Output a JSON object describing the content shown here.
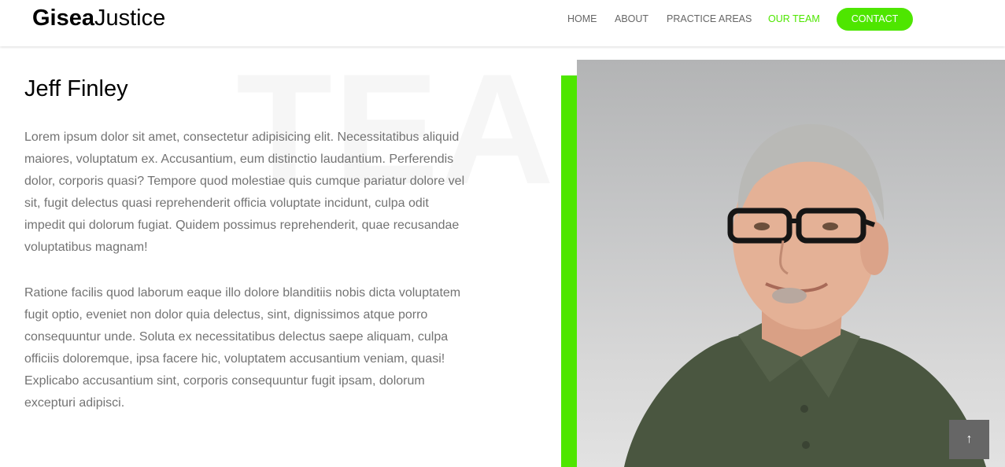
{
  "brand": {
    "bold": "Gisea",
    "regular": "Justice"
  },
  "nav": {
    "items": [
      "HOME",
      "ABOUT",
      "PRACTICE AREAS",
      "OUR TEAM"
    ],
    "active": "OUR TEAM",
    "contact": "CONTACT"
  },
  "colors": {
    "accent": "#4ee600",
    "text_muted": "#737373"
  },
  "background_word": "TEAM",
  "profile": {
    "name": "Jeff Finley",
    "paragraphs": [
      "Lorem ipsum dolor sit amet, consectetur adipisicing elit. Necessitatibus aliquid maiores, voluptatum ex. Accusantium, eum distinctio laudantium. Perferendis dolor, corporis quasi? Tempore quod molestiae quis cumque pariatur dolore vel sit, fugit delectus quasi reprehenderit officia voluptate incidunt, culpa odit impedit qui dolorum fugiat. Quidem possimus reprehenderit, quae recusandae voluptatibus magnam!",
      "Ratione facilis quod laborum eaque illo dolore blanditiis nobis dicta voluptatem fugit optio, eveniet non dolor quia delectus, sint, dignissimos atque porro consequuntur unde. Soluta ex necessitatibus delectus saepe aliquam, culpa officiis doloremque, ipsa facere hic, voluptatem accusantium veniam, quasi! Explicabo accusantium sint, corporis consequuntur fugit ipsam, dolorum excepturi adipisci."
    ]
  },
  "icons": {
    "scroll_top": "arrow-up-icon"
  },
  "scroll_top_glyph": "↑"
}
